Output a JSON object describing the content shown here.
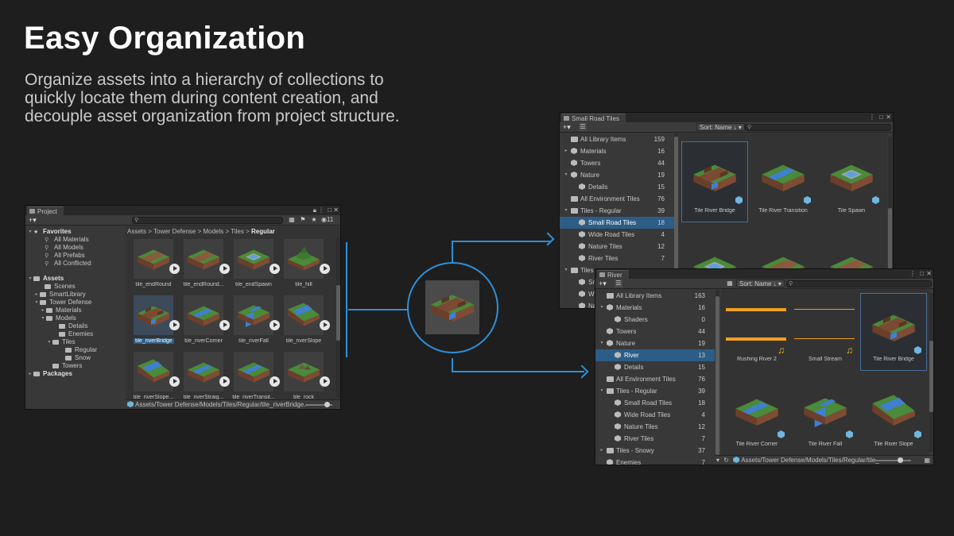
{
  "headline": "Easy Organization",
  "subtext": "Organize assets into a hierarchy of collections to quickly locate them during content creation, and decouple asset organization from project structure.",
  "accent_color": "#2f8fd8",
  "project": {
    "tab": "Project",
    "hidden_count": "11",
    "tree": [
      {
        "label": "Favorites",
        "bold": true
      },
      {
        "label": "All Materials"
      },
      {
        "label": "All Models"
      },
      {
        "label": "All Prefabs"
      },
      {
        "label": "All Conflicted"
      },
      {
        "label": "Assets",
        "bold": true
      },
      {
        "label": "Scenes"
      },
      {
        "label": "SmartLibrary"
      },
      {
        "label": "Tower Defense"
      },
      {
        "label": "Materials"
      },
      {
        "label": "Models"
      },
      {
        "label": "Details"
      },
      {
        "label": "Enemies"
      },
      {
        "label": "Tiles"
      },
      {
        "label": "Regular"
      },
      {
        "label": "Snow"
      },
      {
        "label": "Towers"
      },
      {
        "label": "Packages",
        "bold": true
      }
    ],
    "breadcrumb": [
      "Assets",
      "Tower Defense",
      "Models",
      "Tiles",
      "Regular"
    ],
    "items": [
      "tile_endRound",
      "tile_endRound...",
      "tile_endSpawn",
      "tile_hill",
      "tile_riverBridge",
      "tile_riverCorner",
      "tile_riverFall",
      "tile_riverSlope",
      "tile_riverSlope...",
      "tile_riverStraig...",
      "tile_riverTransit...",
      "tile_rock"
    ],
    "selected_item": "tile_riverBridge",
    "status_path": "Assets/Tower Defense/Models/Tiles/Regular/tile_riverBridge."
  },
  "small_road": {
    "tab": "Small Road Tiles",
    "sort": "Sort: Name ↓",
    "tree": [
      {
        "label": "All Library Items",
        "count": "159"
      },
      {
        "label": "Materials",
        "count": "16"
      },
      {
        "label": "Towers",
        "count": "44"
      },
      {
        "label": "Nature",
        "count": "19"
      },
      {
        "label": "Details",
        "count": "15"
      },
      {
        "label": "All Environment  Tiles",
        "count": "76"
      },
      {
        "label": "Tiles - Regular",
        "count": "39"
      },
      {
        "label": "Small Road Tiles",
        "count": "18"
      },
      {
        "label": "Wide Road Tiles",
        "count": "4"
      },
      {
        "label": "Nature Tiles",
        "count": "12"
      },
      {
        "label": "River Tiles",
        "count": "7"
      },
      {
        "label": "Tiles",
        "count": ""
      },
      {
        "label": "Sma",
        "count": ""
      },
      {
        "label": "Wid",
        "count": ""
      },
      {
        "label": "Natu",
        "count": ""
      }
    ],
    "items": [
      "Tile River Bridge",
      "Tile River Transition",
      "Tile Spawn",
      "",
      "",
      ""
    ]
  },
  "river": {
    "tab": "River",
    "sort": "Sort: Name ↓",
    "tree": [
      {
        "label": "All Library Items",
        "count": "163"
      },
      {
        "label": "Materials",
        "count": "16"
      },
      {
        "label": "Shaders",
        "count": "0"
      },
      {
        "label": "Towers",
        "count": "44"
      },
      {
        "label": "Nature",
        "count": "19"
      },
      {
        "label": "River",
        "count": "13"
      },
      {
        "label": "Details",
        "count": "15"
      },
      {
        "label": "All Environment  Tiles",
        "count": "76"
      },
      {
        "label": "Tiles - Regular",
        "count": "39"
      },
      {
        "label": "Small Road Tiles",
        "count": "18"
      },
      {
        "label": "Wide Road Tiles",
        "count": "4"
      },
      {
        "label": "Nature Tiles",
        "count": "12"
      },
      {
        "label": "River Tiles",
        "count": "7"
      },
      {
        "label": "Tiles - Snowy",
        "count": "37"
      },
      {
        "label": "Enemies",
        "count": "7"
      }
    ],
    "items": [
      "Rushing River 2",
      "Small Stream",
      "Tile River Bridge",
      "Tile River Corner",
      "Tile River Fall",
      "Tile River Slope"
    ],
    "status_path": "Assets/Tower Defense/Models/Tiles/Regular/tile_"
  }
}
